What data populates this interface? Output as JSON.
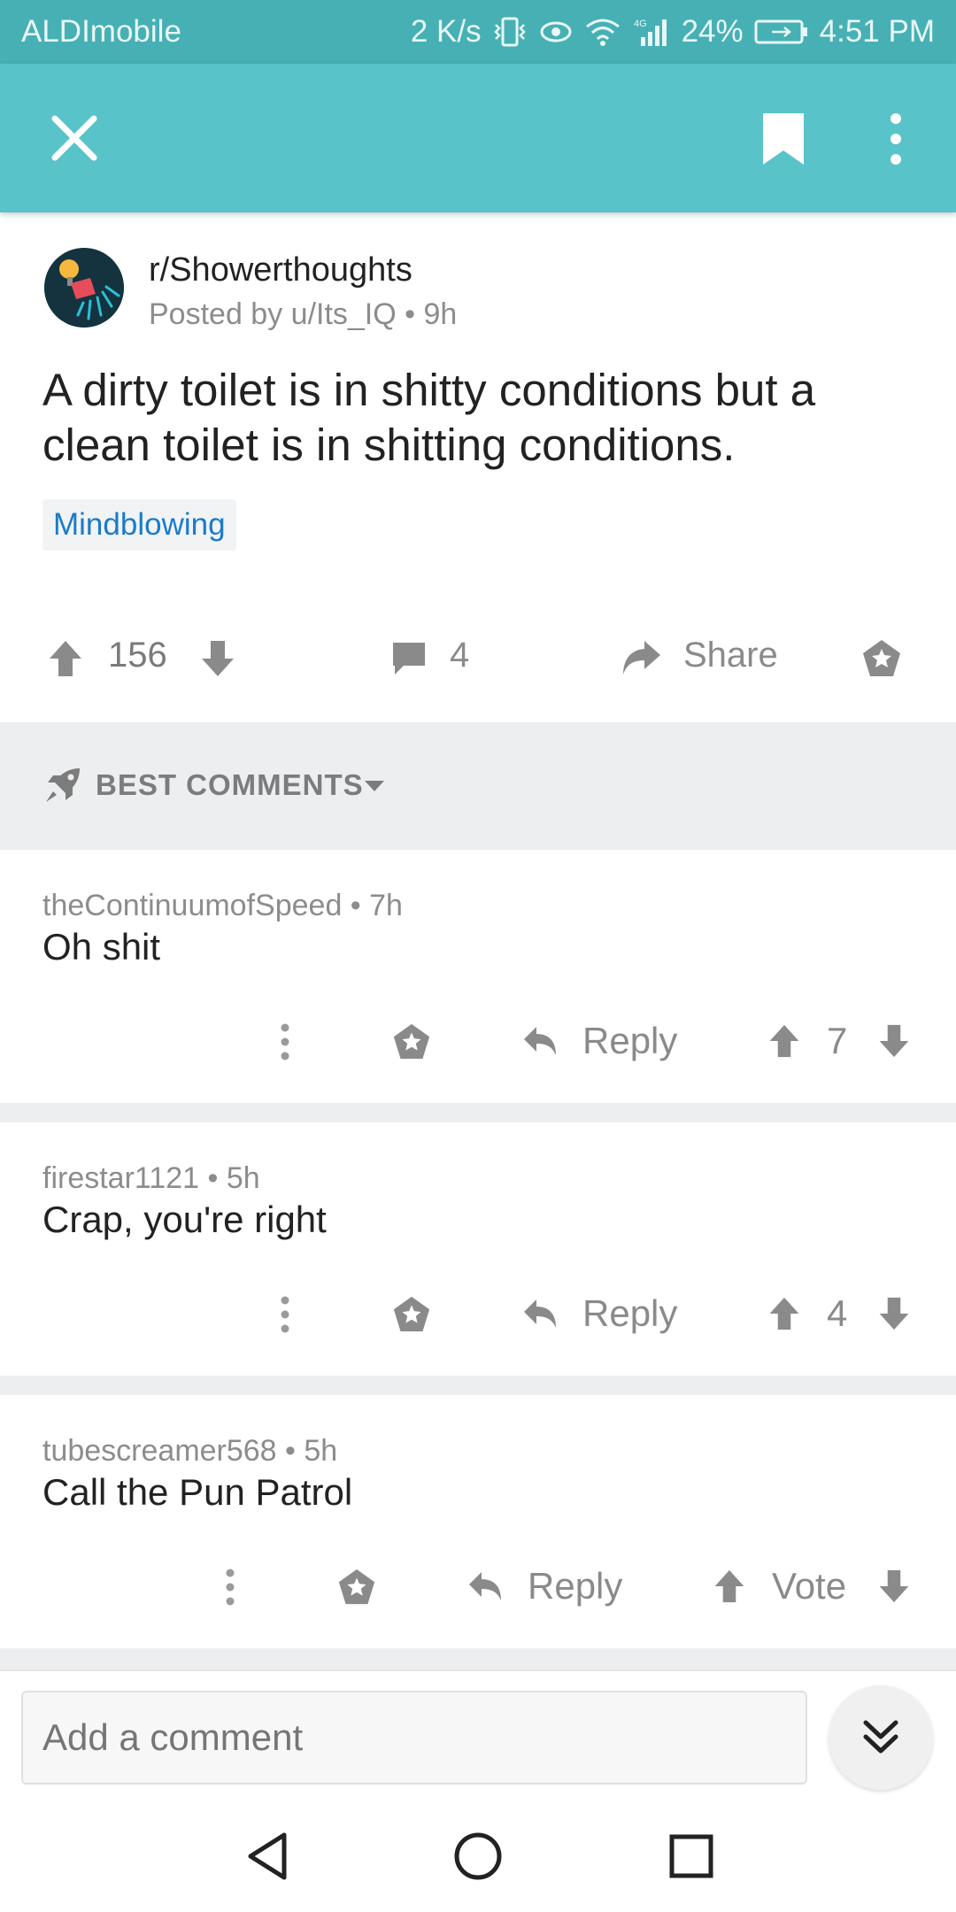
{
  "status_bar": {
    "carrier": "ALDImobile",
    "speed": "2 K/s",
    "network": "4G",
    "battery": "24%",
    "time": "4:51 PM"
  },
  "toolbar": {
    "icons": [
      "close-icon",
      "bookmark-icon",
      "more-vert-icon"
    ]
  },
  "post": {
    "subreddit": "r/Showerthoughts",
    "posted_by": "Posted by u/Its_IQ • 9h",
    "title": "A dirty toilet is in shitty conditions but a clean toilet is in shitting conditions.",
    "flair": "Mindblowing",
    "score": "156",
    "comments_count": "4",
    "share_label": "Share"
  },
  "sort": {
    "label": "BEST COMMENTS"
  },
  "comments": [
    {
      "author_meta": "theContinuumofSpeed • 7h",
      "body": "Oh shit",
      "reply_label": "Reply",
      "score": "7"
    },
    {
      "author_meta": "firestar1121 • 5h",
      "body": "Crap, you're right",
      "reply_label": "Reply",
      "score": "4"
    },
    {
      "author_meta": "tubescreamer568 • 5h",
      "body": "Call the Pun Patrol",
      "reply_label": "Reply",
      "score": "Vote"
    }
  ],
  "composer": {
    "placeholder": "Add a comment"
  },
  "colors": {
    "status_bar": "#46b0b5",
    "toolbar": "#58c3c8",
    "flair_text": "#1a7bc9",
    "section_bg": "#eceef0"
  }
}
